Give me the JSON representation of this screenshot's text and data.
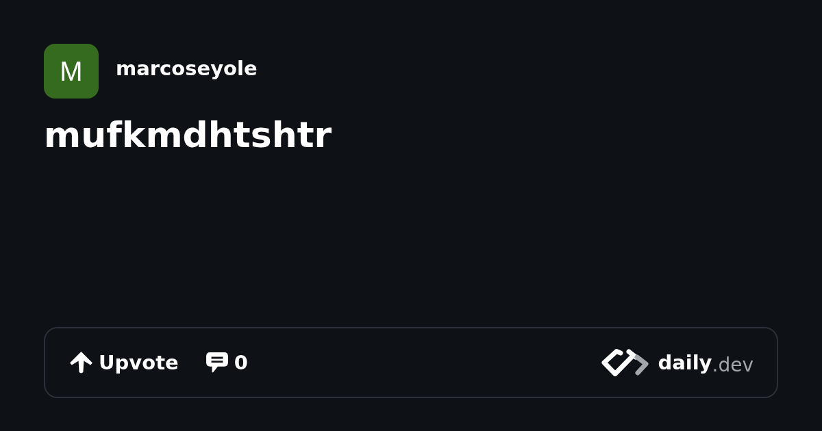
{
  "author": {
    "initial": "M",
    "name": "marcoseyole"
  },
  "title": "mufkmdhtshtr",
  "actions": [
    {
      "kind": "upvote",
      "label": "Upvote"
    },
    {
      "kind": "comments",
      "label": "0"
    }
  ],
  "logo": {
    "name": "daily",
    "suffix": ".dev"
  }
}
